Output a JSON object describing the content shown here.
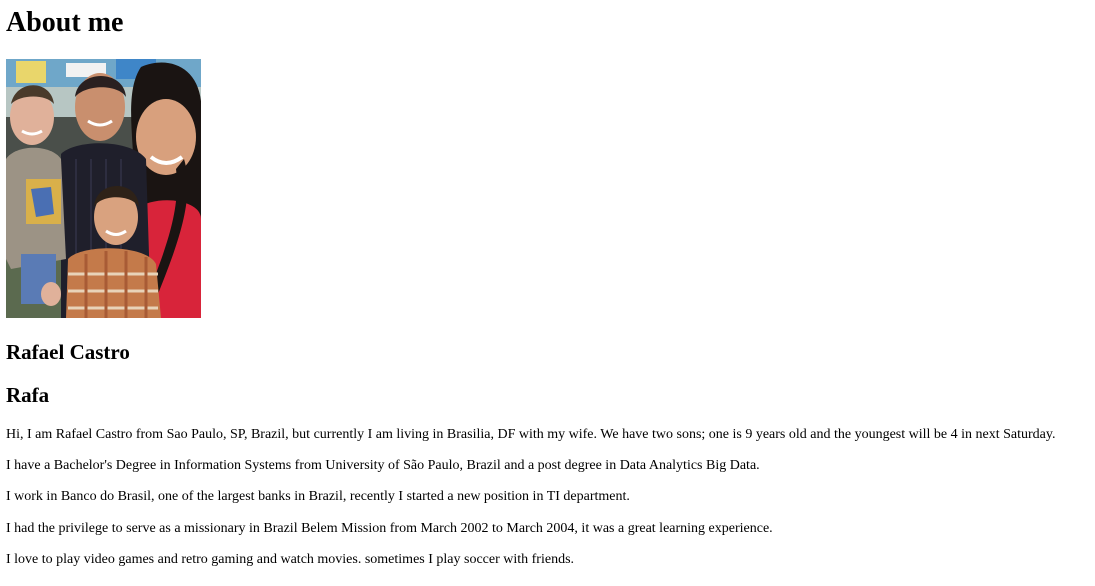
{
  "page": {
    "title": "About me",
    "name": "Rafael Castro",
    "nickname": "Rafa",
    "paragraphs": [
      "Hi, I am Rafael Castro from Sao Paulo, SP, Brazil, but currently I am living in Brasilia, DF with my wife. We have two sons; one is 9 years old and the youngest will be 4 in next Saturday.",
      "I have a Bachelor's Degree in Information Systems from University of São Paulo, Brazil and a post degree in Data Analytics Big Data.",
      "I work in Banco do Brasil, one of the largest banks in Brazil, recently I started a new position in TI department.",
      "I had the privilege to serve as a missionary in Brazil Belem Mission from March 2002 to March 2004, it was a great learning experience.",
      "I love to play video games and retro gaming and watch movies. sometimes I play soccer with friends."
    ]
  },
  "photo": {
    "icon": "family-photo"
  }
}
